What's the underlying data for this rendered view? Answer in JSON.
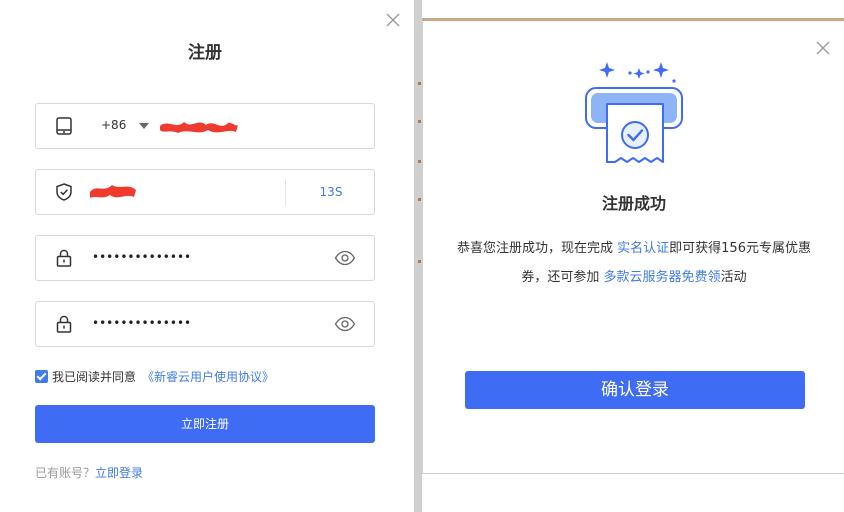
{
  "register": {
    "title": "注册",
    "phone": {
      "country_code": "+86",
      "value": ""
    },
    "sms_code": {
      "value": "",
      "timer": "13S"
    },
    "password": {
      "masked": "••••••••••••••"
    },
    "confirm_password": {
      "masked": "••••••••••••••"
    },
    "agreement": {
      "checked": true,
      "text": "我已阅读并同意",
      "link": "《新睿云用户使用协议》"
    },
    "submit_label": "立即注册",
    "login_tip": {
      "text": "已有账号？",
      "link": "立即登录"
    }
  },
  "dialog": {
    "title": "注册成功",
    "message": {
      "part1": "恭喜您注册成功，现在完成 ",
      "link1": "实名认证",
      "part2": "即可获得156元专属优惠券，还可参加 ",
      "link2": "多款云服务器免费领",
      "part3": "活动"
    },
    "confirm_label": "确认登录"
  },
  "colors": {
    "primary": "#3f6cf5",
    "link": "#3f7be9",
    "redaction": "#f03a2e"
  },
  "icons": {
    "close": "close-icon",
    "phone": "tablet-icon",
    "shield": "shield-check-icon",
    "lock": "lock-icon",
    "eye": "eye-icon",
    "illustration": "printed-receipt-check-illustration"
  }
}
